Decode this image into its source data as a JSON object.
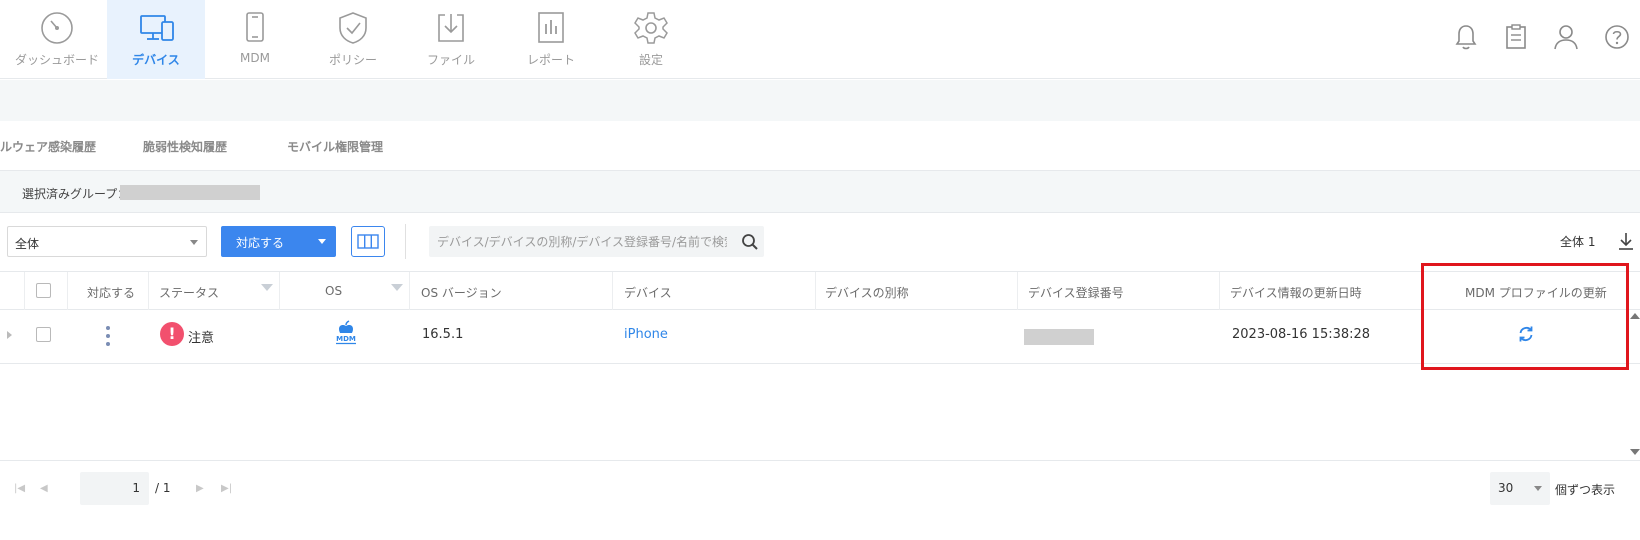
{
  "nav": {
    "items": [
      {
        "label": "ダッシュボード",
        "icon": "gauge-icon",
        "active": false
      },
      {
        "label": "デバイス",
        "icon": "monitor-icon",
        "active": true
      },
      {
        "label": "MDM",
        "icon": "phone-icon",
        "active": false
      },
      {
        "label": "ポリシー",
        "icon": "shield-check-icon",
        "active": false
      },
      {
        "label": "ファイル",
        "icon": "download-box-icon",
        "active": false
      },
      {
        "label": "レポート",
        "icon": "report-chart-icon",
        "active": false
      },
      {
        "label": "設定",
        "icon": "gear-icon",
        "active": false
      }
    ],
    "right_icons": [
      "bell-icon",
      "clipboard-icon",
      "user-icon",
      "help-icon"
    ]
  },
  "subtabs": [
    "ルウェア感染履歴",
    "脆弱性検知履歴",
    "モバイル権限管理"
  ],
  "group": {
    "label": "選択済みグループ："
  },
  "toolbar": {
    "filter_value": "全体",
    "action_label": "対応する",
    "search_placeholder": "デバイス/デバイスの別称/デバイス登録番号/名前で検索",
    "total": "全体 1"
  },
  "table": {
    "headers": {
      "action": "対応する",
      "status": "ステータス",
      "os": "OS",
      "os_version": "OS バージョン",
      "device": "デバイス",
      "alias": "デバイスの別称",
      "reg_no": "デバイス登録番号",
      "updated": "デバイス情報の更新日時",
      "mdm_update": "MDM プロファイルの更新"
    },
    "rows": [
      {
        "status": "注意",
        "status_badge": "!",
        "os_badge": "MDM",
        "os_version": "16.5.1",
        "device": "iPhone",
        "alias": "",
        "updated": "2023-08-16 15:38:28"
      }
    ]
  },
  "pager": {
    "current": "1",
    "total": "/ 1",
    "per_page": "30",
    "per_page_label": "個ずつ表示"
  },
  "colors": {
    "accent": "#3b86ee",
    "highlight": "#e0161d",
    "alert": "#f2506e"
  }
}
